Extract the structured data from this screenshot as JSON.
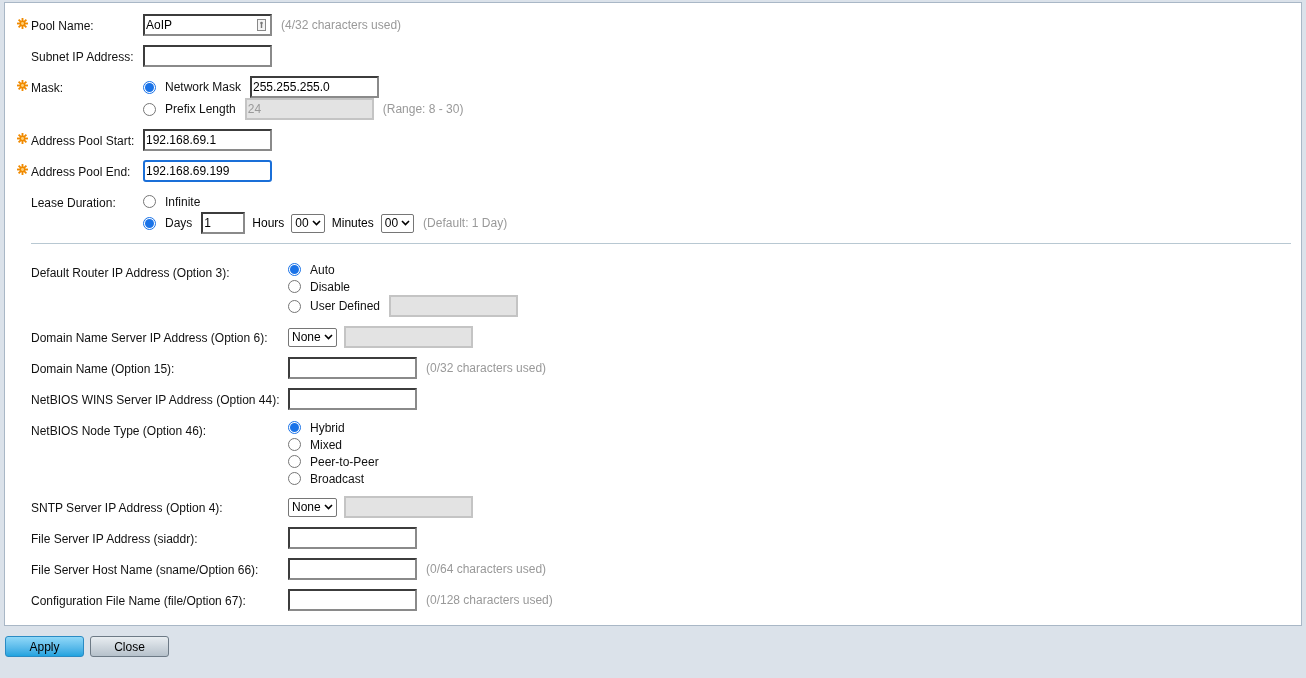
{
  "general_rows": [
    {
      "label": "Pool Name:",
      "required": true,
      "controls": [
        {
          "kind": "input",
          "value": "AoIP",
          "disabled": false,
          "focused": false,
          "has_icon": true
        },
        {
          "kind": "hint",
          "text": "(4/32 characters used)"
        }
      ]
    },
    {
      "label": "Subnet IP Address:",
      "required": false,
      "controls": [
        {
          "kind": "input",
          "disabled": false,
          "focused": false
        }
      ]
    },
    {
      "label": "Mask:",
      "required": true,
      "options": [
        {
          "label": "Network Mask",
          "selected": true,
          "controls": [
            {
              "kind": "input",
              "value": "255.255.255.0",
              "disabled": false,
              "focused": false
            }
          ]
        },
        {
          "label": "Prefix Length",
          "selected": false,
          "controls": [
            {
              "kind": "input",
              "value": "24",
              "disabled": true
            },
            {
              "kind": "hint",
              "text": "(Range: 8 - 30)"
            }
          ]
        }
      ]
    },
    {
      "label": "Address Pool Start:",
      "required": true,
      "controls": [
        {
          "kind": "input",
          "value": "192.168.69.1",
          "disabled": false,
          "focused": false
        }
      ]
    },
    {
      "label": "Address Pool End:",
      "required": true,
      "controls": [
        {
          "kind": "input",
          "value": "192.168.69.199",
          "disabled": false,
          "focused": true
        }
      ]
    },
    {
      "label": "Lease Duration:",
      "required": false,
      "options": [
        {
          "label": "Infinite",
          "selected": false
        },
        {
          "label": "Days",
          "selected": true,
          "controls": [
            {
              "kind": "small_input",
              "value": "1",
              "disabled": false,
              "focused": false
            },
            {
              "kind": "label",
              "text": "Hours"
            },
            {
              "kind": "select",
              "value": "00"
            },
            {
              "kind": "label",
              "text": "Minutes"
            },
            {
              "kind": "select",
              "value": "00"
            },
            {
              "kind": "hint",
              "text": "(Default: 1 Day)"
            }
          ]
        }
      ]
    }
  ],
  "option_rows": [
    {
      "label": "Default Router IP Address (Option 3):",
      "options": [
        {
          "label": "Auto",
          "selected": true
        },
        {
          "label": "Disable",
          "selected": false
        },
        {
          "label": "User Defined",
          "selected": false,
          "controls": [
            {
              "kind": "input",
              "disabled": true
            }
          ]
        }
      ]
    },
    {
      "label": "Domain Name Server IP Address (Option 6):",
      "controls": [
        {
          "kind": "select",
          "value": "None"
        },
        {
          "kind": "input",
          "disabled": true
        }
      ]
    },
    {
      "label": "Domain Name (Option 15):",
      "controls": [
        {
          "kind": "input",
          "disabled": false,
          "focused": false
        },
        {
          "kind": "hint",
          "text": "(0/32 characters used)"
        }
      ]
    },
    {
      "label": "NetBIOS WINS Server IP Address (Option 44):",
      "controls": [
        {
          "kind": "input",
          "disabled": false,
          "focused": false
        }
      ]
    },
    {
      "label": "NetBIOS Node Type (Option 46):",
      "options": [
        {
          "label": "Hybrid",
          "selected": true
        },
        {
          "label": "Mixed",
          "selected": false
        },
        {
          "label": "Peer-to-Peer",
          "selected": false
        },
        {
          "label": "Broadcast",
          "selected": false
        }
      ]
    },
    {
      "label": "SNTP Server IP Address (Option 4):",
      "controls": [
        {
          "kind": "select",
          "value": "None"
        },
        {
          "kind": "input",
          "disabled": true
        }
      ]
    },
    {
      "label": "File Server IP Address (siaddr):",
      "controls": [
        {
          "kind": "input",
          "disabled": false,
          "focused": false
        }
      ]
    },
    {
      "label": "File Server Host Name (sname/Option 66):",
      "controls": [
        {
          "kind": "input",
          "disabled": false,
          "focused": false
        },
        {
          "kind": "hint",
          "text": "(0/64 characters used)"
        }
      ]
    },
    {
      "label": "Configuration File Name (file/Option 67):",
      "controls": [
        {
          "kind": "input",
          "disabled": false,
          "focused": false
        },
        {
          "kind": "hint",
          "text": "(0/128 characters used)"
        }
      ]
    }
  ],
  "buttons": [
    {
      "label": "Apply",
      "primary": true
    },
    {
      "label": "Close",
      "primary": false
    }
  ]
}
